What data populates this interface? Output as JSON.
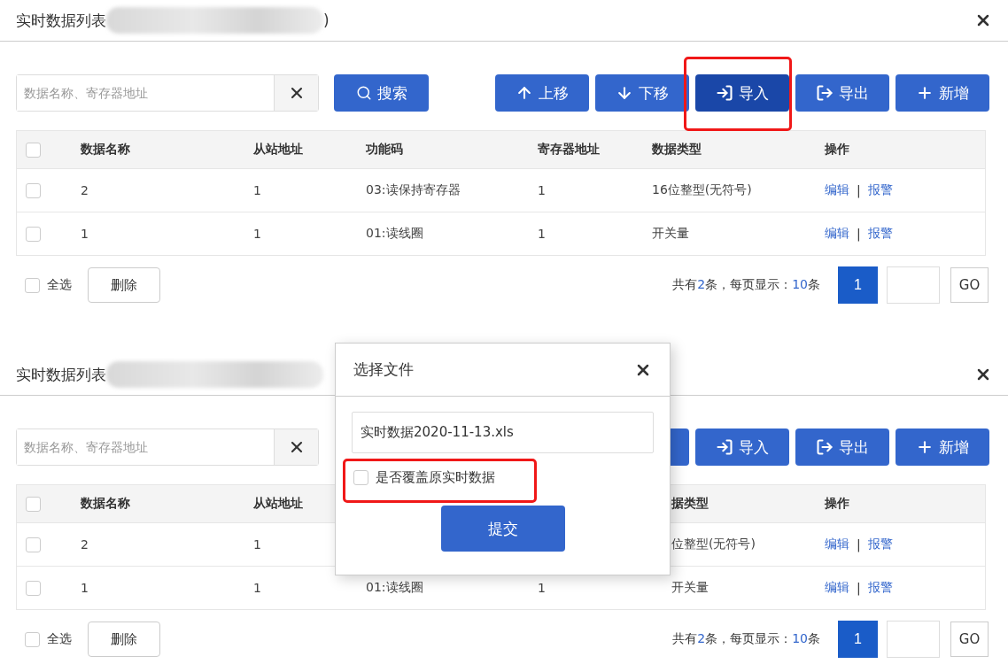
{
  "panels": [
    {
      "title": "实时数据列表",
      "title_tail": ")",
      "search": {
        "placeholder": "数据名称、寄存器地址",
        "button": "搜索"
      },
      "toolbar": [
        {
          "kind": "up",
          "label": "上移",
          "pressed": false
        },
        {
          "kind": "down",
          "label": "下移",
          "pressed": false
        },
        {
          "kind": "import",
          "label": "导入",
          "pressed": true,
          "highlighted": true
        },
        {
          "kind": "export",
          "label": "导出",
          "pressed": false
        },
        {
          "kind": "add",
          "label": "新增",
          "pressed": false
        }
      ],
      "columns": {
        "name": "数据名称",
        "slave": "从站地址",
        "func": "功能码",
        "reg": "寄存器地址",
        "type": "数据类型",
        "ops": "操作"
      },
      "header_checked": false,
      "rows": [
        {
          "checked": false,
          "name": "2",
          "slave": "1",
          "func": "03:读保持寄存器",
          "reg": "1",
          "type": "16位整型(无符号)",
          "edit": "编辑",
          "sep": "|",
          "alarm": "报警"
        },
        {
          "checked": false,
          "name": "1",
          "slave": "1",
          "func": "01:读线圈",
          "reg": "1",
          "type": "开关量",
          "edit": "编辑",
          "sep": "|",
          "alarm": "报警"
        }
      ],
      "footer": {
        "select_all": "全选",
        "select_all_checked": false,
        "delete": "删除",
        "summary": {
          "prefix": "共有",
          "total": "2",
          "middle": "条，每页显示：",
          "size": "10",
          "suffix": "条"
        },
        "pages": [
          {
            "label": "1",
            "selected": true
          }
        ],
        "go": "GO"
      }
    },
    {
      "title": "实时数据列表",
      "search": {
        "placeholder": "数据名称、寄存器地址"
      },
      "toolbar": [
        {
          "kind": "down",
          "pressed": false
        },
        {
          "kind": "import",
          "label": "导入",
          "pressed": false
        },
        {
          "kind": "export",
          "label": "导出",
          "pressed": false
        },
        {
          "kind": "add",
          "label": "新增",
          "pressed": false
        }
      ],
      "columns": {
        "name": "数据名称",
        "slave": "从站地址",
        "type": "据类型",
        "ops": "操作"
      },
      "header_checked": false,
      "rows": [
        {
          "checked": false,
          "name": "2",
          "slave": "1",
          "type": "位整型(无符号)",
          "edit": "编辑",
          "sep": "|",
          "alarm": "报警"
        },
        {
          "checked": false,
          "name": "1",
          "slave": "1",
          "func": "01:读线圈",
          "reg": "1",
          "type": "开关量",
          "edit": "编辑",
          "sep": "|",
          "alarm": "报警"
        }
      ],
      "footer": {
        "select_all": "全选",
        "select_all_checked": false,
        "delete": "删除",
        "summary": {
          "prefix": "共有",
          "total": "2",
          "middle": "条，每页显示：",
          "size": "10",
          "suffix": "条"
        },
        "pages": [
          {
            "label": "1",
            "selected": true
          }
        ],
        "go": "GO"
      },
      "dialog": {
        "title": "选择文件",
        "file": "实时数据2020-11-13.xls",
        "overwrite_label": "是否覆盖原实时数据",
        "overwrite_checked": false,
        "overwrite_highlighted": true,
        "submit": "提交"
      }
    }
  ]
}
